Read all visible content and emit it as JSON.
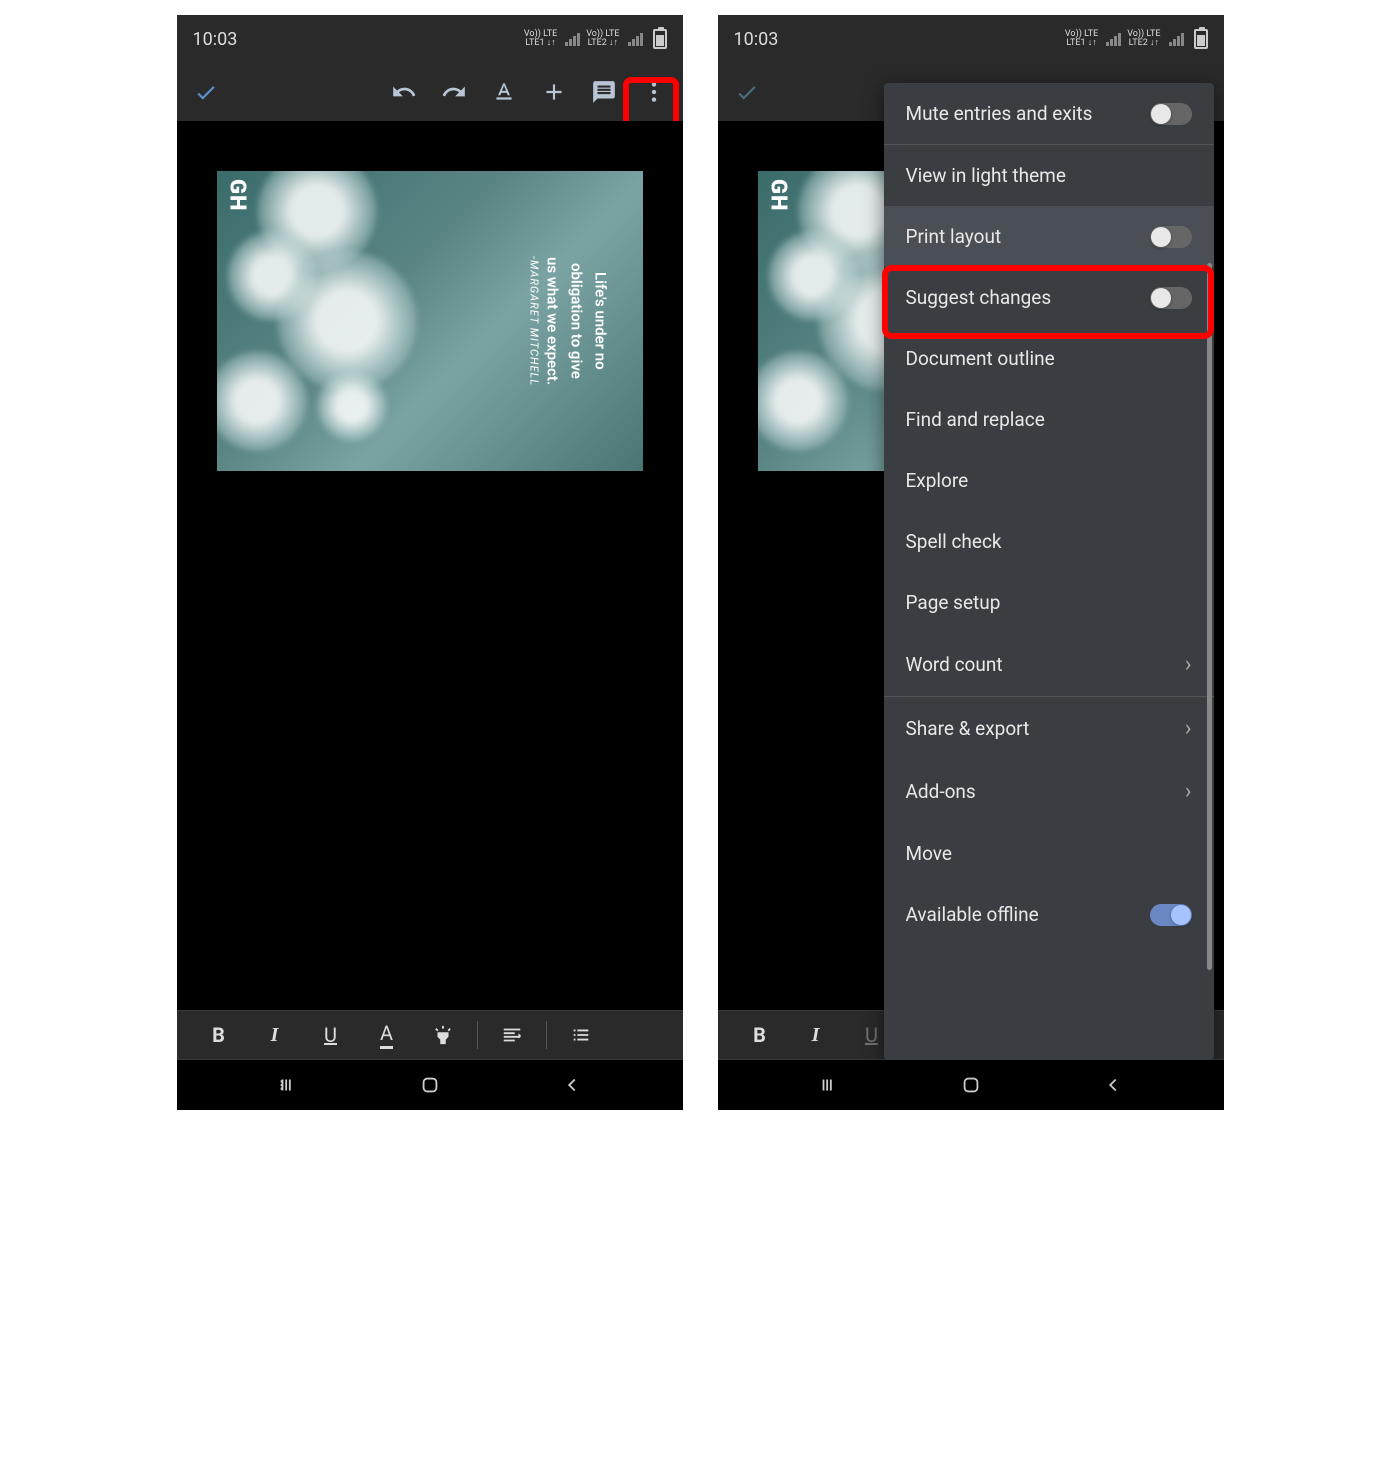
{
  "status": {
    "time": "10:03",
    "lte1_top": "Vo)) LTE",
    "lte1_bottom": "LTE1 ↓↑",
    "lte2_top": "Vo)) LTE",
    "lte2_bottom": "LTE2 ↓↑"
  },
  "doc_image": {
    "logo": "GH",
    "quote_l1": "Life's under no",
    "quote_l2": "obligation to give",
    "quote_l3": "us what we expect.",
    "author": "-MARGARET MITCHELL"
  },
  "menu": {
    "mute": "Mute entries and exits",
    "light_theme": "View in light theme",
    "print_layout": "Print layout",
    "suggest": "Suggest changes",
    "outline": "Document outline",
    "find": "Find and replace",
    "explore": "Explore",
    "spell": "Spell check",
    "page_setup": "Page setup",
    "word_count": "Word count",
    "share": "Share & export",
    "addons": "Add-ons",
    "move": "Move",
    "offline": "Available offline"
  }
}
